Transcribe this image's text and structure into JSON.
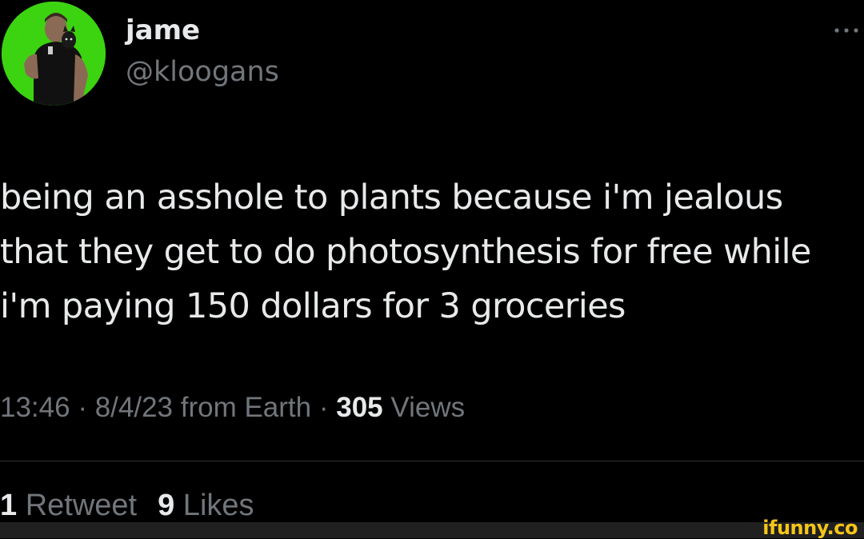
{
  "author": {
    "display_name": "jame",
    "handle": "@kloogans"
  },
  "tweet": {
    "lines": [
      "being an asshole to plants because i'm jealous",
      "that they get to do photosynthesis for free while",
      "i'm paying 150 dollars for 3 groceries"
    ]
  },
  "meta": {
    "time": "13:46",
    "sep1": " · ",
    "date": "8/4/23",
    "source": " from Earth",
    "sep2": " · ",
    "views_count": "305",
    "views_label": " Views"
  },
  "stats": {
    "retweets_count": "1",
    "retweets_label": " Retweet",
    "likes_count": "9",
    "likes_label": " Likes"
  },
  "watermark": "ifunny.co",
  "colors": {
    "background": "#000000",
    "primary_text": "#e7e9ea",
    "secondary_text": "#71767b",
    "avatar_bg": "#3cd411",
    "watermark": "#f5c518"
  },
  "icons": {
    "more": "more-horizontal-icon"
  }
}
